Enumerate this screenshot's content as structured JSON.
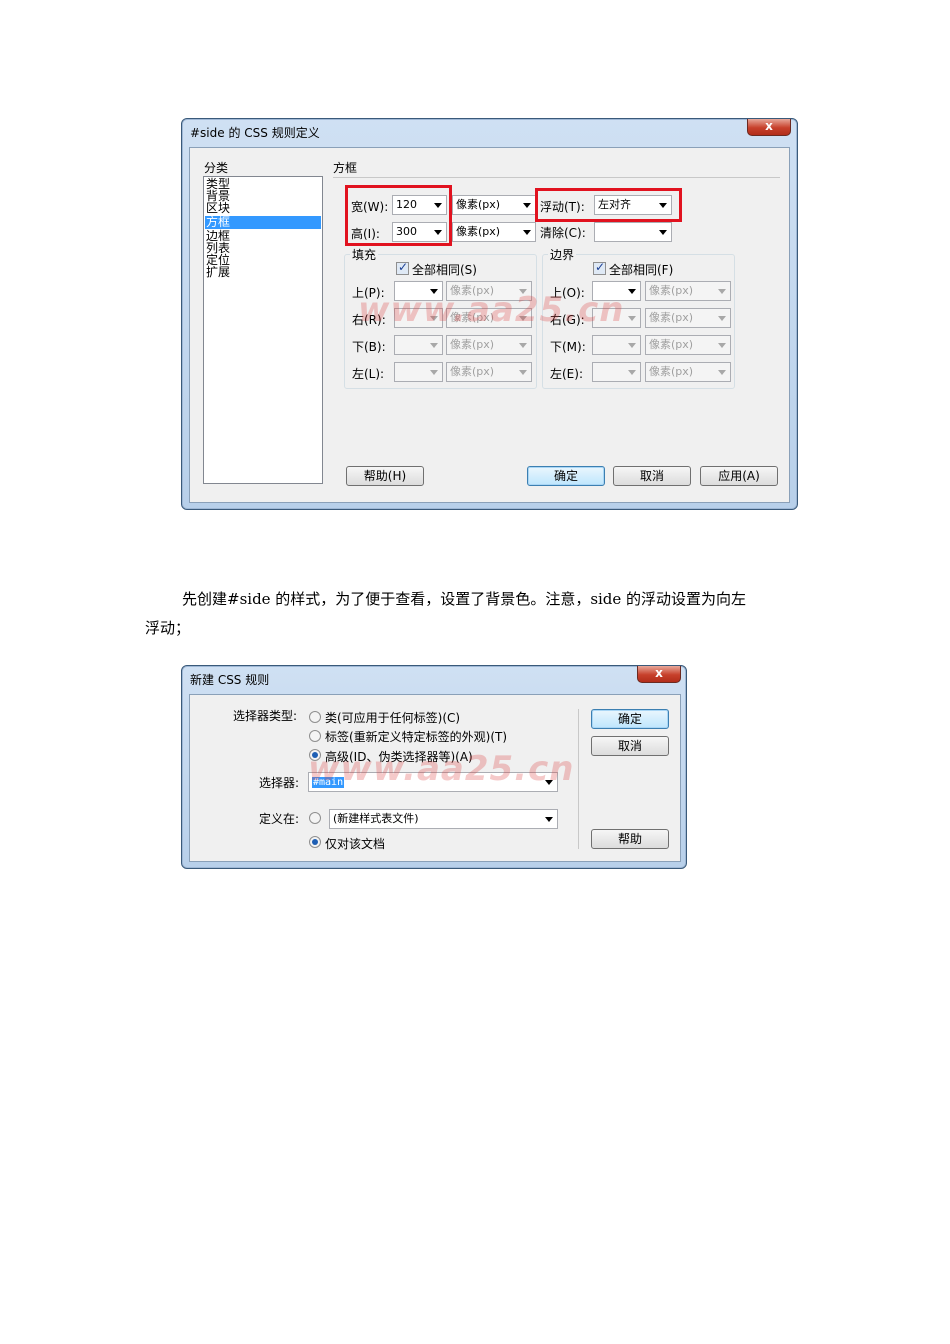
{
  "dialog1": {
    "title": "#side 的 CSS 规则定义",
    "close_label": "x",
    "category_header": "分类",
    "categories": [
      "类型",
      "背景",
      "区块",
      "方框",
      "边框",
      "列表",
      "定位",
      "扩展"
    ],
    "selected_category": "方框",
    "panel_title": "方框",
    "width_label": "宽(W):",
    "width_value": "120",
    "height_label": "高(I):",
    "height_value": "300",
    "unit_px": "像素(px)",
    "float_label": "浮动(T):",
    "float_value": "左对齐",
    "clear_label": "清除(C):",
    "clear_value": "",
    "padding_group": "填充",
    "margin_group": "边界",
    "same_padding": "全部相同(S)",
    "same_margin": "全部相同(F)",
    "padding_rows": [
      "上(P):",
      "右(R):",
      "下(B):",
      "左(L):"
    ],
    "margin_rows": [
      "上(O):",
      "右(G):",
      "下(M):",
      "左(E):"
    ],
    "help_button": "帮助(H)",
    "ok_button": "确定",
    "cancel_button": "取消",
    "apply_button": "应用(A)"
  },
  "paragraph": {
    "line1": "先创建#side 的样式，为了便于查看，设置了背景色。注意，side 的浮动设置为向左",
    "line2": "浮动；"
  },
  "dialog2": {
    "title": "新建 CSS 规则",
    "close_label": "x",
    "selector_type_label": "选择器类型:",
    "option_class": "类(可应用于任何标签)(C)",
    "option_tag": "标签(重新定义特定标签的外观)(T)",
    "option_advanced": "高级(ID、伪类选择器等)(A)",
    "selector_label": "选择器:",
    "selector_value": "#main",
    "define_in_label": "定义在:",
    "define_new_file": "(新建样式表文件)",
    "define_this_doc": "仅对该文档",
    "ok_button": "确定",
    "cancel_button": "取消",
    "help_button": "帮助"
  },
  "watermark": "www.aa25.cn",
  "colors": {
    "highlight": "#e1121f",
    "selection": "#3399ff",
    "watermark": "#dc3c3c"
  }
}
